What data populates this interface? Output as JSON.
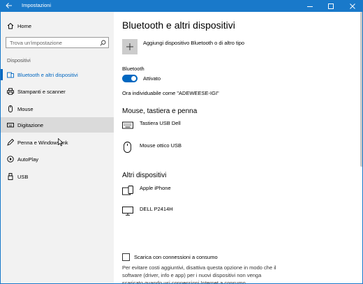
{
  "window": {
    "title": "Impostazioni",
    "accent": "#1979ca"
  },
  "sidebar": {
    "home_label": "Home",
    "search": {
      "placeholder": "Trova un'impostazione"
    },
    "section_label": "Dispositivi",
    "items": [
      {
        "label": "Bluetooth e altri dispositivi",
        "icon": "bluetooth-devices-icon",
        "active": true
      },
      {
        "label": "Stampanti e scanner",
        "icon": "printer-icon",
        "active": false
      },
      {
        "label": "Mouse",
        "icon": "mouse-icon",
        "active": false
      },
      {
        "label": "Digitazione",
        "icon": "keyboard-icon",
        "active": false,
        "hover": true
      },
      {
        "label": "Penna e Windows Ink",
        "icon": "pen-icon",
        "active": false
      },
      {
        "label": "AutoPlay",
        "icon": "autoplay-icon",
        "active": false
      },
      {
        "label": "USB",
        "icon": "usb-icon",
        "active": false
      }
    ]
  },
  "main": {
    "title": "Bluetooth e altri dispositivi",
    "add_device_label": "Aggiungi dispositivo Bluetooth o di altro tipo",
    "bluetooth": {
      "label": "Bluetooth",
      "state": "Attivato",
      "on": true,
      "discoverable_text": "Ora individuabile come \"ADEWEESE-IGI\""
    },
    "input_section": {
      "heading": "Mouse, tastiera e penna",
      "devices": [
        {
          "name": "Tastiera USB Dell",
          "icon": "keyboard-icon"
        },
        {
          "name": "Mouse ottico USB",
          "icon": "mouse-icon"
        }
      ]
    },
    "other_section": {
      "heading": "Altri dispositivi",
      "devices": [
        {
          "name": "Apple iPhone",
          "icon": "phone-icon"
        },
        {
          "name": "DELL P2414H",
          "icon": "monitor-icon"
        }
      ]
    },
    "metered": {
      "checkbox_label": "Scarica con connessioni a consumo",
      "checked": false,
      "description": "Per evitare costi aggiuntivi, disattiva questa opzione in modo che il software (driver, info e app) per i nuovi dispositivi non venga scaricato quando usi connessioni Internet a consumo."
    }
  }
}
